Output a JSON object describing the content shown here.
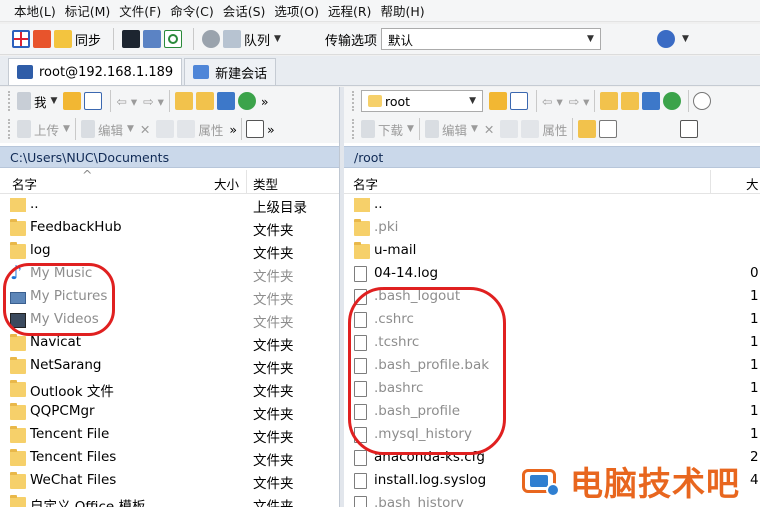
{
  "menu": [
    "本地(L)",
    "标记(M)",
    "文件(F)",
    "命令(C)",
    "会话(S)",
    "选项(O)",
    "远程(R)",
    "帮助(H)"
  ],
  "toolbar": {
    "sync_label": "同步",
    "queue_label": "队列",
    "transfer_options_label": "传输选项",
    "transfer_options_value": "默认"
  },
  "tabs": [
    {
      "label": "root@192.168.1.189",
      "active": true
    },
    {
      "label": "新建会话",
      "active": false
    }
  ],
  "left": {
    "location_combo": "我",
    "upload_label": "上传",
    "edit_label": "编辑",
    "properties_label": "属性",
    "path": "C:\\Users\\NUC\\Documents",
    "columns": {
      "name": "名字",
      "size": "大小",
      "type": "类型"
    },
    "rows": [
      {
        "name": "..",
        "type": "上级目录",
        "icon": "parent-dir-icon",
        "faded": false
      },
      {
        "name": "FeedbackHub",
        "type": "文件夹",
        "icon": "folder-icon",
        "faded": false
      },
      {
        "name": "log",
        "type": "文件夹",
        "icon": "folder-icon",
        "faded": false
      },
      {
        "name": "My Music",
        "type": "文件夹",
        "icon": "music-note-icon",
        "faded": true
      },
      {
        "name": "My Pictures",
        "type": "文件夹",
        "icon": "picture-icon",
        "faded": true
      },
      {
        "name": "My Videos",
        "type": "文件夹",
        "icon": "video-icon",
        "faded": true
      },
      {
        "name": "Navicat",
        "type": "文件夹",
        "icon": "folder-icon",
        "faded": false
      },
      {
        "name": "NetSarang",
        "type": "文件夹",
        "icon": "folder-icon",
        "faded": false
      },
      {
        "name": "Outlook 文件",
        "type": "文件夹",
        "icon": "folder-icon",
        "faded": false
      },
      {
        "name": "QQPCMgr",
        "type": "文件夹",
        "icon": "folder-icon",
        "faded": false
      },
      {
        "name": "Tencent File",
        "type": "文件夹",
        "icon": "folder-icon",
        "faded": false
      },
      {
        "name": "Tencent Files",
        "type": "文件夹",
        "icon": "folder-icon",
        "faded": false
      },
      {
        "name": "WeChat Files",
        "type": "文件夹",
        "icon": "folder-icon",
        "faded": false
      },
      {
        "name": "自定义 Office 模板",
        "type": "文件夹",
        "icon": "folder-icon",
        "faded": false
      }
    ]
  },
  "right": {
    "location_combo": "root",
    "download_label": "下载",
    "edit_label": "编辑",
    "properties_label": "属性",
    "path": "/root",
    "columns": {
      "name": "名字",
      "size": "大"
    },
    "rows": [
      {
        "name": "..",
        "size": "",
        "icon": "parent-dir-icon",
        "faded": false
      },
      {
        "name": ".pki",
        "size": "",
        "icon": "folder-icon",
        "faded": true
      },
      {
        "name": "u-mail",
        "size": "",
        "icon": "folder-icon",
        "faded": false
      },
      {
        "name": "04-14.log",
        "size": "0",
        "icon": "file-icon",
        "faded": false
      },
      {
        "name": ".bash_logout",
        "size": "1",
        "icon": "file-icon",
        "faded": true
      },
      {
        "name": ".cshrc",
        "size": "1",
        "icon": "file-icon",
        "faded": true
      },
      {
        "name": ".tcshrc",
        "size": "1",
        "icon": "file-icon",
        "faded": true
      },
      {
        "name": ".bash_profile.bak",
        "size": "1",
        "icon": "file-icon",
        "faded": true
      },
      {
        "name": ".bashrc",
        "size": "1",
        "icon": "file-icon",
        "faded": true
      },
      {
        "name": ".bash_profile",
        "size": "1",
        "icon": "file-icon",
        "faded": true
      },
      {
        "name": ".mysql_history",
        "size": "1",
        "icon": "file-icon",
        "faded": true
      },
      {
        "name": "anaconda-ks.cfg",
        "size": "2",
        "icon": "file-icon",
        "faded": false
      },
      {
        "name": "install.log.syslog",
        "size": "4",
        "icon": "file-icon",
        "faded": false
      },
      {
        "name": ".bash_history",
        "size": "",
        "icon": "file-icon",
        "faded": true
      }
    ]
  },
  "watermark": {
    "text": "电脑技术吧"
  },
  "colors": {
    "highlight_circle": "#e02020",
    "path_bar": "#cad8ea",
    "watermark": "#e8661e",
    "folder": "#f6d06a"
  }
}
